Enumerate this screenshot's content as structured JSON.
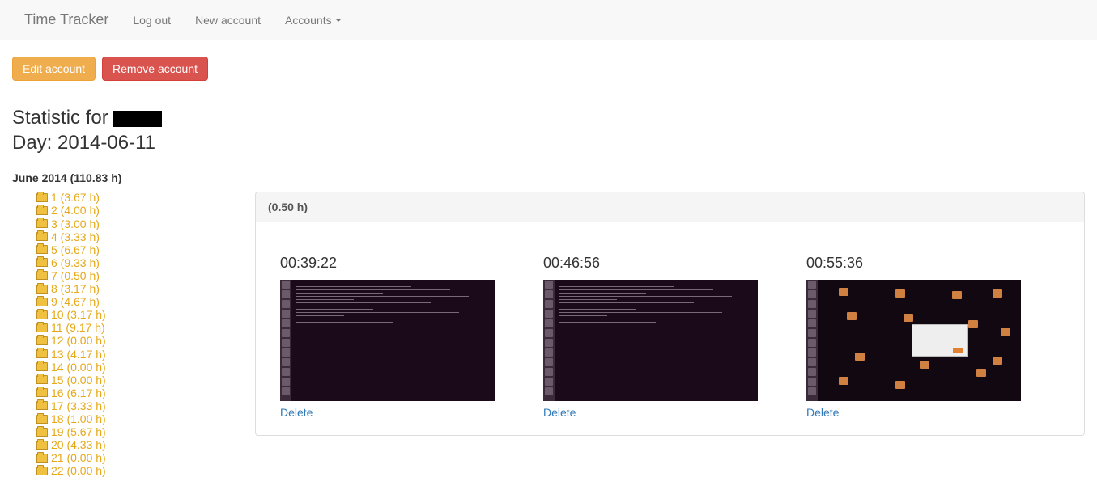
{
  "navbar": {
    "brand": "Time Tracker",
    "logout": "Log out",
    "new_account": "New account",
    "accounts": "Accounts"
  },
  "buttons": {
    "edit": "Edit account",
    "remove": "Remove account"
  },
  "heading": {
    "prefix": "Statistic for ",
    "day_prefix": "Day: ",
    "date": "2014-06-11"
  },
  "month": {
    "label": "June 2014 (110.83 h)"
  },
  "days": [
    {
      "label": "1 (3.67 h)"
    },
    {
      "label": "2 (4.00 h)"
    },
    {
      "label": "3 (3.00 h)"
    },
    {
      "label": "4 (3.33 h)"
    },
    {
      "label": "5 (6.67 h)"
    },
    {
      "label": "6 (9.33 h)"
    },
    {
      "label": "7 (0.50 h)"
    },
    {
      "label": "8 (3.17 h)"
    },
    {
      "label": "9 (4.67 h)"
    },
    {
      "label": "10 (3.17 h)"
    },
    {
      "label": "11 (9.17 h)"
    },
    {
      "label": "12 (0.00 h)"
    },
    {
      "label": "13 (4.17 h)"
    },
    {
      "label": "14 (0.00 h)"
    },
    {
      "label": "15 (0.00 h)"
    },
    {
      "label": "16 (6.17 h)"
    },
    {
      "label": "17 (3.33 h)"
    },
    {
      "label": "18 (1.00 h)"
    },
    {
      "label": "19 (5.67 h)"
    },
    {
      "label": "20 (4.33 h)"
    },
    {
      "label": "21 (0.00 h)"
    },
    {
      "label": "22 (0.00 h)"
    }
  ],
  "panel": {
    "title": "(0.50 h)"
  },
  "screenshots": [
    {
      "time": "00:39:22",
      "delete": "Delete",
      "type": "terminal"
    },
    {
      "time": "00:46:56",
      "delete": "Delete",
      "type": "terminal"
    },
    {
      "time": "00:55:36",
      "delete": "Delete",
      "type": "desktop"
    }
  ]
}
